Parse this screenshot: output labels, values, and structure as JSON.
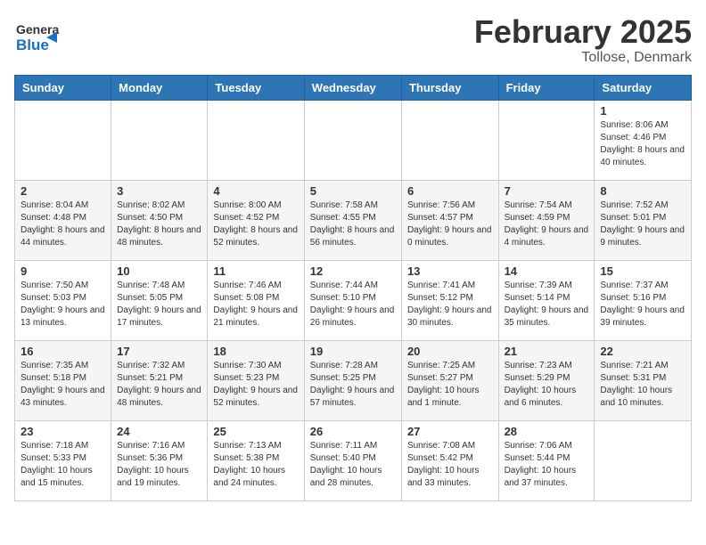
{
  "header": {
    "logo_general": "General",
    "logo_blue": "Blue",
    "title": "February 2025",
    "subtitle": "Tollose, Denmark"
  },
  "weekdays": [
    "Sunday",
    "Monday",
    "Tuesday",
    "Wednesday",
    "Thursday",
    "Friday",
    "Saturday"
  ],
  "weeks": [
    [
      {
        "day": "",
        "info": ""
      },
      {
        "day": "",
        "info": ""
      },
      {
        "day": "",
        "info": ""
      },
      {
        "day": "",
        "info": ""
      },
      {
        "day": "",
        "info": ""
      },
      {
        "day": "",
        "info": ""
      },
      {
        "day": "1",
        "info": "Sunrise: 8:06 AM\nSunset: 4:46 PM\nDaylight: 8 hours and 40 minutes."
      }
    ],
    [
      {
        "day": "2",
        "info": "Sunrise: 8:04 AM\nSunset: 4:48 PM\nDaylight: 8 hours and 44 minutes."
      },
      {
        "day": "3",
        "info": "Sunrise: 8:02 AM\nSunset: 4:50 PM\nDaylight: 8 hours and 48 minutes."
      },
      {
        "day": "4",
        "info": "Sunrise: 8:00 AM\nSunset: 4:52 PM\nDaylight: 8 hours and 52 minutes."
      },
      {
        "day": "5",
        "info": "Sunrise: 7:58 AM\nSunset: 4:55 PM\nDaylight: 8 hours and 56 minutes."
      },
      {
        "day": "6",
        "info": "Sunrise: 7:56 AM\nSunset: 4:57 PM\nDaylight: 9 hours and 0 minutes."
      },
      {
        "day": "7",
        "info": "Sunrise: 7:54 AM\nSunset: 4:59 PM\nDaylight: 9 hours and 4 minutes."
      },
      {
        "day": "8",
        "info": "Sunrise: 7:52 AM\nSunset: 5:01 PM\nDaylight: 9 hours and 9 minutes."
      }
    ],
    [
      {
        "day": "9",
        "info": "Sunrise: 7:50 AM\nSunset: 5:03 PM\nDaylight: 9 hours and 13 minutes."
      },
      {
        "day": "10",
        "info": "Sunrise: 7:48 AM\nSunset: 5:05 PM\nDaylight: 9 hours and 17 minutes."
      },
      {
        "day": "11",
        "info": "Sunrise: 7:46 AM\nSunset: 5:08 PM\nDaylight: 9 hours and 21 minutes."
      },
      {
        "day": "12",
        "info": "Sunrise: 7:44 AM\nSunset: 5:10 PM\nDaylight: 9 hours and 26 minutes."
      },
      {
        "day": "13",
        "info": "Sunrise: 7:41 AM\nSunset: 5:12 PM\nDaylight: 9 hours and 30 minutes."
      },
      {
        "day": "14",
        "info": "Sunrise: 7:39 AM\nSunset: 5:14 PM\nDaylight: 9 hours and 35 minutes."
      },
      {
        "day": "15",
        "info": "Sunrise: 7:37 AM\nSunset: 5:16 PM\nDaylight: 9 hours and 39 minutes."
      }
    ],
    [
      {
        "day": "16",
        "info": "Sunrise: 7:35 AM\nSunset: 5:18 PM\nDaylight: 9 hours and 43 minutes."
      },
      {
        "day": "17",
        "info": "Sunrise: 7:32 AM\nSunset: 5:21 PM\nDaylight: 9 hours and 48 minutes."
      },
      {
        "day": "18",
        "info": "Sunrise: 7:30 AM\nSunset: 5:23 PM\nDaylight: 9 hours and 52 minutes."
      },
      {
        "day": "19",
        "info": "Sunrise: 7:28 AM\nSunset: 5:25 PM\nDaylight: 9 hours and 57 minutes."
      },
      {
        "day": "20",
        "info": "Sunrise: 7:25 AM\nSunset: 5:27 PM\nDaylight: 10 hours and 1 minute."
      },
      {
        "day": "21",
        "info": "Sunrise: 7:23 AM\nSunset: 5:29 PM\nDaylight: 10 hours and 6 minutes."
      },
      {
        "day": "22",
        "info": "Sunrise: 7:21 AM\nSunset: 5:31 PM\nDaylight: 10 hours and 10 minutes."
      }
    ],
    [
      {
        "day": "23",
        "info": "Sunrise: 7:18 AM\nSunset: 5:33 PM\nDaylight: 10 hours and 15 minutes."
      },
      {
        "day": "24",
        "info": "Sunrise: 7:16 AM\nSunset: 5:36 PM\nDaylight: 10 hours and 19 minutes."
      },
      {
        "day": "25",
        "info": "Sunrise: 7:13 AM\nSunset: 5:38 PM\nDaylight: 10 hours and 24 minutes."
      },
      {
        "day": "26",
        "info": "Sunrise: 7:11 AM\nSunset: 5:40 PM\nDaylight: 10 hours and 28 minutes."
      },
      {
        "day": "27",
        "info": "Sunrise: 7:08 AM\nSunset: 5:42 PM\nDaylight: 10 hours and 33 minutes."
      },
      {
        "day": "28",
        "info": "Sunrise: 7:06 AM\nSunset: 5:44 PM\nDaylight: 10 hours and 37 minutes."
      },
      {
        "day": "",
        "info": ""
      }
    ]
  ]
}
